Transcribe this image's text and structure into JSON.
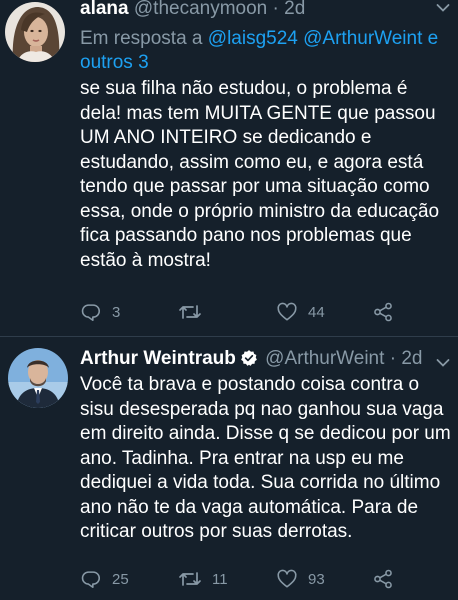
{
  "tweet1": {
    "name": "alana",
    "handle": "@thecanymoon",
    "dot": "·",
    "time": "2d",
    "reply_prefix": "Em resposta a ",
    "reply_users": "@laisg524 @ArthurWeint e outros 3",
    "body": "se sua filha não estudou, o problema é dela! mas tem MUITA GENTE que passou UM ANO INTEIRO se dedicando e estudando, assim como eu, e agora está tendo que passar por uma situação como essa, onde o próprio ministro da educação fica passando pano nos problemas que estão à mostra!",
    "replies": "3",
    "retweets": "",
    "likes": "44"
  },
  "tweet2": {
    "name": "Arthur Weintraub",
    "handle": "@ArthurWeint",
    "dot": "·",
    "time": "2d",
    "body": "Você ta brava e postando coisa contra o sisu desesperada pq nao ganhou sua vaga em direito ainda. Disse q se dedicou por um ano. Tadinha. Pra entrar na usp eu me dediquei a vida toda. Sua corrida no último ano não te da vaga automática. Para de criticar outros por suas derrotas.",
    "replies": "25",
    "retweets": "11",
    "likes": "93"
  },
  "icons": {
    "reply": "reply-icon",
    "retweet": "retweet-icon",
    "like": "heart-icon",
    "share": "share-icon",
    "verified": "verified-badge-icon",
    "caret": "chevron-down-icon"
  },
  "colors": {
    "background": "#15202b",
    "text": "#ffffff",
    "secondary": "#8899a6",
    "link": "#1da1f2"
  }
}
